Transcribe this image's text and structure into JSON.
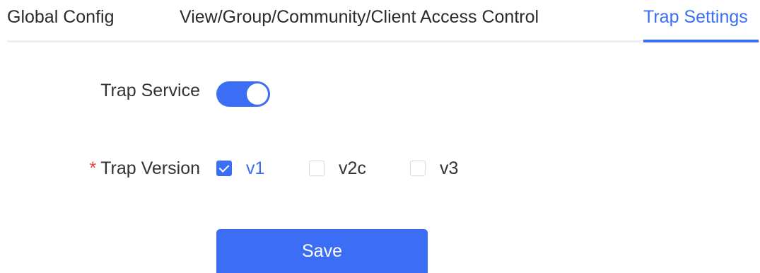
{
  "tabs": {
    "global": "Global Config",
    "view": "View/Group/Community/Client Access Control",
    "trap": "Trap Settings",
    "active": "Trap Settings"
  },
  "form": {
    "trap_service_label": "Trap Service",
    "trap_service_enabled": true,
    "trap_version_required_mark": "*",
    "trap_version_label": "Trap Version",
    "trap_versions": [
      {
        "label": "v1",
        "checked": true
      },
      {
        "label": "v2c",
        "checked": false
      },
      {
        "label": "v3",
        "checked": false
      }
    ]
  },
  "actions": {
    "save_label": "Save"
  },
  "colors": {
    "accent": "#3b6ef5",
    "required": "#f04040",
    "text": "#333333",
    "divider": "#eef0f4"
  }
}
